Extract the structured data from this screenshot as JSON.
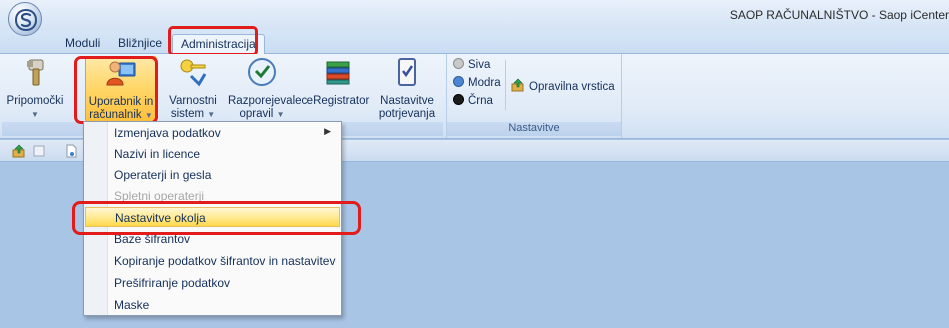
{
  "window": {
    "title": "SAOP RAČUNALNIŠTVO - Saop iCenter"
  },
  "tabs": [
    {
      "label": "Moduli"
    },
    {
      "label": "Bližnjice"
    },
    {
      "label": "Administracija"
    }
  ],
  "ribbon": {
    "buttons": [
      {
        "label": "Pripomočki"
      },
      {
        "label_line1": "Uporabnik in",
        "label_line2": "računalnik"
      },
      {
        "label_line1": "Varnostni",
        "label_line2": "sistem"
      },
      {
        "label_line1": "Razporejevalec",
        "label_line2": "opravil"
      },
      {
        "label": "eRegistrator"
      },
      {
        "label_line1": "Nastavitve",
        "label_line2": "potrjevanja"
      }
    ],
    "themes": [
      {
        "label": "Siva",
        "color": "#c9c9c9"
      },
      {
        "label": "Modra",
        "color": "#4c86d0"
      },
      {
        "label": "Črna",
        "color": "#1c1c1c"
      }
    ],
    "opravilna_label": "Opravilna vrstica",
    "group_nastavitve_label": "Nastavitve"
  },
  "menu": {
    "items": [
      {
        "label": "Izmenjava podatkov",
        "submenu": true
      },
      {
        "label": "Nazivi in licence"
      },
      {
        "label": "Operaterji in gesla"
      },
      {
        "label": "Spletni operaterji",
        "disabled": true
      },
      {
        "label": "Nastavitve okolja",
        "highlighted": true
      },
      {
        "label": "Baze šifrantov"
      },
      {
        "label": "Kopiranje podatkov šifrantov in nastavitev"
      },
      {
        "label": "Prešifriranje podatkov"
      },
      {
        "label": "Maske"
      }
    ]
  },
  "colors": {
    "highlight_red": "#e21b1b",
    "ribbon_bg": "#dfeaf7",
    "main_bg": "#a9c5e6"
  }
}
